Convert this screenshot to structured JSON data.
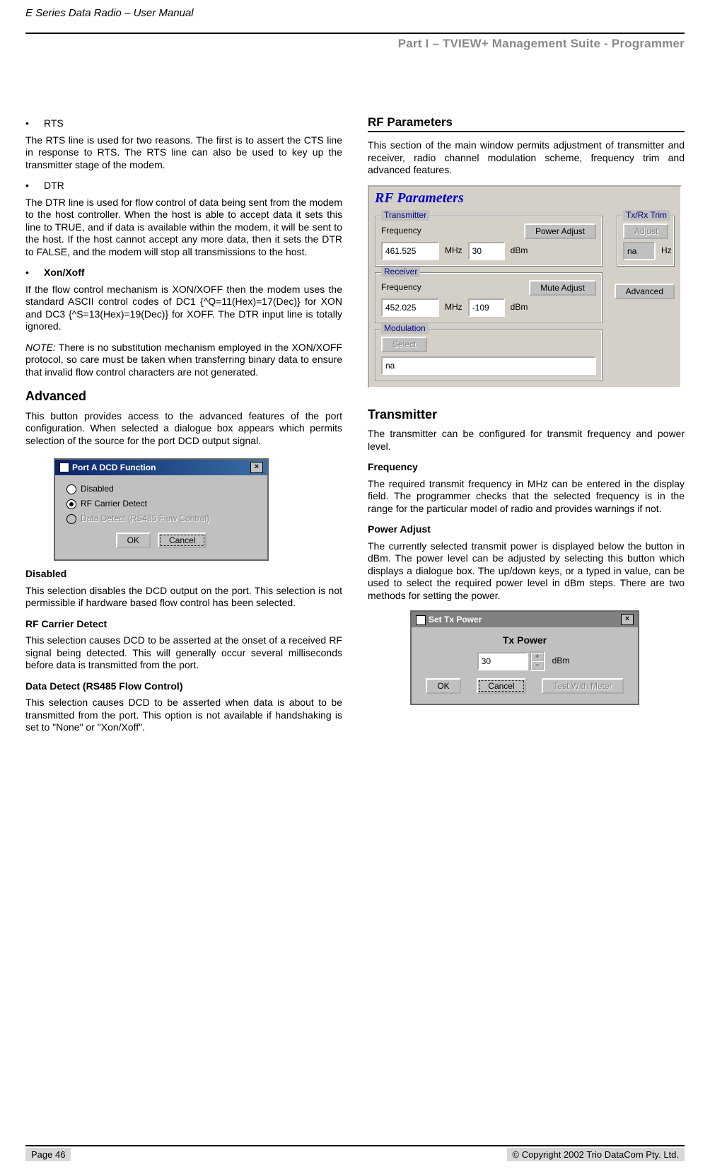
{
  "header": {
    "book_title": "E Series Data Radio – User Manual",
    "section_title": "Part I – TVIEW+ Management Suite - Programmer"
  },
  "left": {
    "rts_label": "RTS",
    "rts_body": "The RTS line is used for two reasons.  The first is to assert the CTS line in response to RTS. The RTS line can also be used to key up the transmitter stage of the modem.",
    "dtr_label": "DTR",
    "dtr_body": "The DTR line is used for flow control of data being sent from the modem to the host controller.  When the host is able to accept data it sets this line to TRUE, and if data is available within the modem, it will be sent to the host.  If the host cannot accept any more data, then it sets the DTR to FALSE, and the modem will stop all transmissions to the host.",
    "xon_label": "Xon/Xoff",
    "xon_body1": "If the flow control mechanism is XON/XOFF then the modem uses the standard ASCII control codes of DC1 {^Q=11(Hex)=17(Dec)} for XON and DC3 {^S=13(Hex)=19(Dec)} for XOFF. The DTR input line is totally ignored.",
    "xon_note_lead": "NOTE:",
    "xon_note_body": " There is no substitution mechanism employed in the XON/XOFF protocol, so care must be taken when transferring binary data to ensure that invalid flow control characters are not generated.",
    "advanced_heading": "Advanced",
    "advanced_body": "This button provides access to the advanced features of the port configuration. When selected a dialogue box appears which permits selection of the source for the port DCD output signal.",
    "dcd_dialog": {
      "title": "Port A DCD Function",
      "opt_disabled": "Disabled",
      "opt_rf": "RF Carrier Detect",
      "opt_data": "Data Detect (RS485 Flow Control)",
      "ok": "OK",
      "cancel": "Cancel"
    },
    "sub_disabled_h": "Disabled",
    "sub_disabled_b": "This selection disables the DCD output on the port. This selection is not permissible if hardware based flow control has been selected.",
    "sub_rf_h": "RF Carrier Detect",
    "sub_rf_b": "This selection causes DCD to be asserted at the onset of a received RF signal being detected. This will generally occur several milliseconds before data is transmitted from the port.",
    "sub_data_h": "Data Detect (RS485 Flow Control)",
    "sub_data_b": "This selection causes DCD to be asserted when data is about to be transmitted from the port. This option is not available if handshaking is set to \"None\" or \"Xon/Xoff\"."
  },
  "right": {
    "rf_heading": "RF Parameters",
    "rf_intro": "This section of the main window permits adjustment of transmitter and receiver, radio channel modulation scheme, frequency trim and advanced features.",
    "panel": {
      "title": "RF Parameters",
      "tx_group": "Transmitter",
      "rx_group": "Receiver",
      "trim_group": "Tx/Rx Trim",
      "mod_group": "Modulation",
      "freq_label": "Frequency",
      "power_adjust_btn": "Power Adjust",
      "mute_adjust_btn": "Mute Adjust",
      "adjust_btn": "Adjust",
      "advanced_btn": "Advanced",
      "select_btn": "Select",
      "tx_freq": "461.525",
      "tx_pwr": "30",
      "rx_freq": "452.025",
      "rx_mute": "-109",
      "trim_val": "na",
      "mod_val": "na",
      "mhz": "MHz",
      "dbm": "dBm",
      "hz": "Hz"
    },
    "transmitter_h": "Transmitter",
    "transmitter_b": "The transmitter can be configured for transmit frequency and power level.",
    "freq_h": "Frequency",
    "freq_b": "The required transmit frequency in MHz can be entered in the display field.  The programmer checks that the selected frequency is in the range for the particular model of radio and provides warnings if not.",
    "power_h": "Power Adjust",
    "power_b": "The currently selected transmit power is displayed below the button in dBm. The power level can be adjusted by selecting this button which displays a dialogue box. The up/down keys, or a typed in value, can be used to select the required power level in dBm steps. There are two methods for setting the power.",
    "tx_dialog": {
      "title": "Set Tx Power",
      "heading": "Tx Power",
      "value": "30",
      "unit": "dBm",
      "ok": "OK",
      "cancel": "Cancel",
      "test": "Test With Meter"
    }
  },
  "footer": {
    "page": "Page 46",
    "copyright": "© Copyright 2002 Trio DataCom Pty. Ltd."
  }
}
